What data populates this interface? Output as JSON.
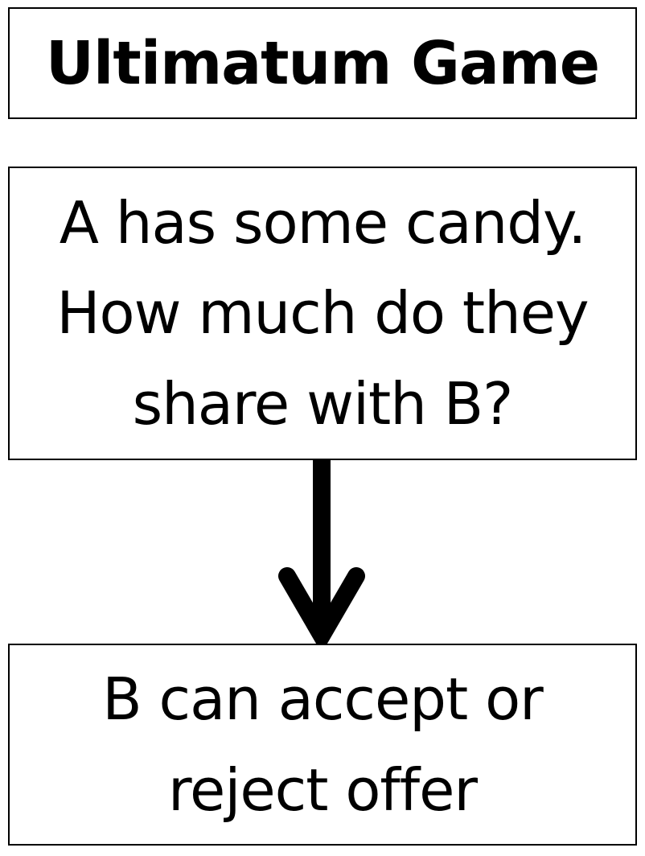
{
  "title": "Ultimatum Game",
  "steps": [
    {
      "text": "A has some candy.\nHow much do they\nshare with B?"
    },
    {
      "text": "B can accept or\nreject offer"
    }
  ],
  "colors": {
    "stroke": "#000000",
    "background": "#ffffff"
  },
  "connector_icon": "down-arrow"
}
